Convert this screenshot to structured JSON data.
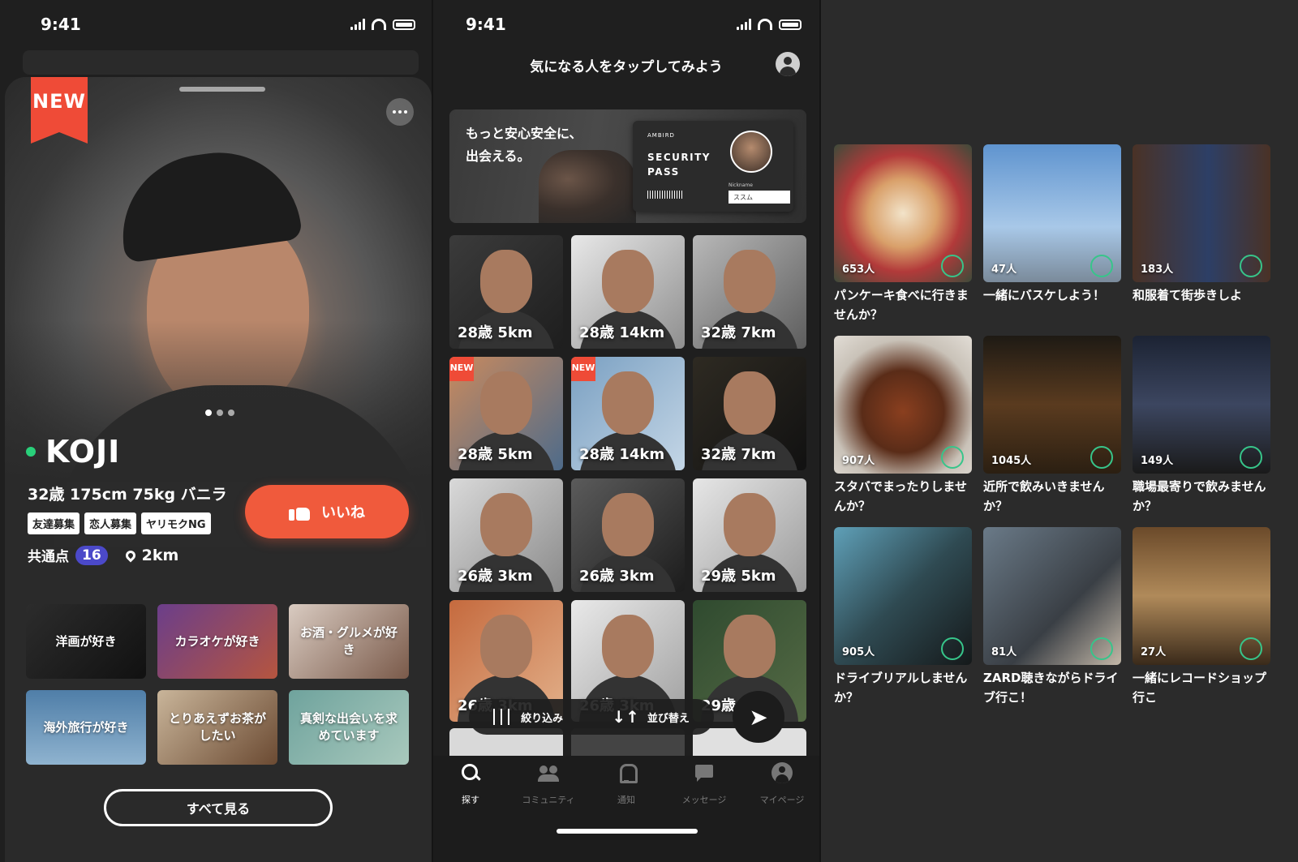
{
  "left": {
    "status": {
      "time": "9:41"
    },
    "profile": {
      "new_badge": "NEW",
      "name": "KOJI",
      "stats": "32歳 175cm 75kg バニラ",
      "tags": [
        "友達募集",
        "恋人募集",
        "ヤリモクNG"
      ],
      "like_label": "いいね",
      "common_label": "共通点",
      "common_count": "16",
      "distance": "2km",
      "photo_count": 3,
      "photo_index": 1
    },
    "interests": [
      {
        "label": "洋画が好き",
        "bg": "linear-gradient(135deg,#2c2c2c,#111)"
      },
      {
        "label": "カラオケが好き",
        "bg": "linear-gradient(135deg,#6b3e8a,#b5553f)"
      },
      {
        "label": "お酒・グルメが好き",
        "bg": "linear-gradient(135deg,#d9cbc1,#7a5a4a)"
      },
      {
        "label": "海外旅行が好き",
        "bg": "linear-gradient(180deg,#4f7ea8,#8fb3cf)"
      },
      {
        "label": "とりあえずお茶がしたい",
        "bg": "linear-gradient(135deg,#c9b59a,#6b4a32)"
      },
      {
        "label": "真剣な出会いを求めています",
        "bg": "linear-gradient(135deg,#6fa39d,#a9c9bd)"
      }
    ],
    "see_all": "すべて見る"
  },
  "mid": {
    "status": {
      "time": "9:41"
    },
    "header": "気になる人をタップしてみよう",
    "banner": {
      "text1": "もっと安心安全に、",
      "text2": "出会える。",
      "brand": "AMBIRD",
      "security1": "SECURITY",
      "security2": "PASS",
      "nickname_label": "Nickname",
      "nickname": "ススム"
    },
    "users": [
      {
        "label": "28歳 5km",
        "new": false,
        "bg": "linear-gradient(135deg,#3b3b3b,#1e1e1e)"
      },
      {
        "label": "28歳 14km",
        "new": false,
        "bg": "linear-gradient(135deg,#e8e8e8,#8f8f8f)"
      },
      {
        "label": "32歳 7km",
        "new": false,
        "bg": "linear-gradient(135deg,#b8b8b8,#5d5d5d)"
      },
      {
        "label": "28歳 5km",
        "new": true,
        "bg": "linear-gradient(135deg,#c98a5e,#4e6b8a)"
      },
      {
        "label": "28歳 14km",
        "new": true,
        "bg": "linear-gradient(135deg,#7aa0c2,#c4d6e6)"
      },
      {
        "label": "32歳 7km",
        "new": false,
        "bg": "linear-gradient(135deg,#2e2a22,#111)"
      },
      {
        "label": "26歳 3km",
        "new": false,
        "bg": "linear-gradient(135deg,#d9d9d9,#8a8a8a)"
      },
      {
        "label": "26歳 3km",
        "new": false,
        "bg": "linear-gradient(135deg,#5b5b5b,#1c1c1c)"
      },
      {
        "label": "29歳 5km",
        "new": false,
        "bg": "linear-gradient(135deg,#e6e6e6,#9a9a9a)"
      }
    ],
    "users_row4": [
      {
        "label": "26歳 3km",
        "bg": "linear-gradient(135deg,#c56a3e,#e2b08a)"
      },
      {
        "label": "26歳 3km",
        "bg": "linear-gradient(135deg,#e9e9e9,#a0a0a0)"
      },
      {
        "label": "29歳 5km",
        "bg": "linear-gradient(135deg,#2f4a2f,#556b45)"
      }
    ],
    "filter_label": "絞り込み",
    "sort_label": "並び替え",
    "tabs": [
      {
        "label": "探す",
        "icon": "search-icon",
        "active": true
      },
      {
        "label": "コミュニティ",
        "icon": "community-icon",
        "active": false
      },
      {
        "label": "通知",
        "icon": "bell-icon",
        "active": false
      },
      {
        "label": "メッセージ",
        "icon": "message-icon",
        "active": false
      },
      {
        "label": "マイページ",
        "icon": "profile-icon",
        "active": false
      }
    ]
  },
  "right": {
    "boards": [
      {
        "count": "653人",
        "title": "パンケーキ食べに行きませんか？",
        "bg": "radial-gradient(circle at 50% 50%,#f2e3c9 0%,#d9a06a 35%,#b23a3a 60%,#3e4b3a 100%)"
      },
      {
        "count": "47人",
        "title": "一緒にバスケしよう！",
        "bg": "linear-gradient(180deg,#5f94cf 0%,#a8c8e8 60%,#7a8a9a 100%)"
      },
      {
        "count": "183人",
        "title": "和服着て街歩きしよ",
        "bg": "linear-gradient(90deg,#4a3226 0%,#2d3f66 55%,#4a3226 100%)"
      },
      {
        "count": "907人",
        "title": "スタバでまったりしませんか？",
        "bg": "radial-gradient(circle at 50% 55%,#8a3f1f 0%,#5a2c18 40%,#c9c2b8 70%,#e2ddd6 100%)"
      },
      {
        "count": "1045人",
        "title": "近所で飲みいきませんか？",
        "bg": "linear-gradient(180deg,#1e1a14 0%,#5a3b1f 50%,#2b1f12 100%)"
      },
      {
        "count": "149人",
        "title": "職場最寄りで飲みませんか？",
        "bg": "linear-gradient(180deg,#1c2333 0%,#3c4660 50%,#1a1a1a 100%)"
      },
      {
        "count": "905人",
        "title": "ドライブリアルしませんか？",
        "bg": "linear-gradient(135deg,#5fa0b8 0%,#2f4a52 50%,#15191a 100%)"
      },
      {
        "count": "81人",
        "title": "ZARD聴きながらドライブ行こ！",
        "bg": "linear-gradient(135deg,#6a7a88 0%,#3a3f45 60%,#c4b8a8 100%)"
      },
      {
        "count": "27人",
        "title": "一緒にレコードショップ行こ",
        "bg": "linear-gradient(180deg,#6b4a2a 0%,#b08a5a 50%,#3a2a1a 100%)"
      }
    ]
  },
  "colors": {
    "accent_orange": "#f05a3c",
    "new_red": "#ef4b37",
    "common_purple": "#4b49c9",
    "online_green": "#29d07a",
    "ring_green": "#37c58a"
  }
}
